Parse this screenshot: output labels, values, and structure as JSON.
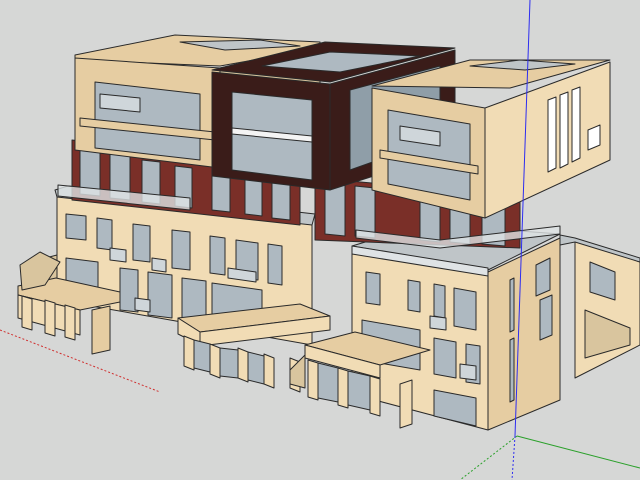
{
  "colors": {
    "sky": "#d6d7d6",
    "cream": "#f1dcb5",
    "cream_shadow": "#d9c59e",
    "tan": "#e6cda2",
    "glass": "#aeb9c1",
    "glass_dark": "#8f9ea8",
    "dark_frame": "#3a1c19",
    "brick": "#7a2f28",
    "roof_grey": "#bfc5c8",
    "axis_blue": "#2d2df0",
    "axis_green": "#2aa02a",
    "axis_red": "#d03030"
  },
  "viewport": {
    "axes": [
      "blue-axis",
      "green-axis",
      "red-axis"
    ]
  }
}
